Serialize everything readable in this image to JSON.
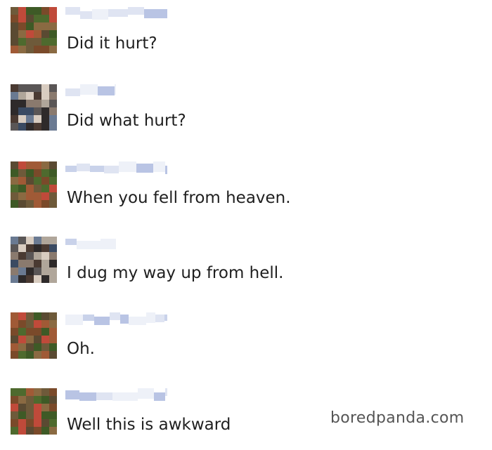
{
  "messages": [
    {
      "sender": "woman",
      "text": "Did it hurt?"
    },
    {
      "sender": "other",
      "text": "Did what hurt?"
    },
    {
      "sender": "woman",
      "text": "When you fell from heaven."
    },
    {
      "sender": "other",
      "text": "I dug my way up from hell."
    },
    {
      "sender": "woman",
      "text": "Oh."
    },
    {
      "sender": "woman",
      "text": "Well this is awkward"
    }
  ],
  "watermark": "boredpanda.com",
  "colors": {
    "sender_blur": [
      "#c9d2ea",
      "#dfe4f2",
      "#b9c4e4",
      "#eef1f8"
    ],
    "avatar_warm": [
      "#6e5a3a",
      "#8a6a42",
      "#4e6a2e",
      "#a05a36",
      "#7a4a2a",
      "#c04a3a",
      "#5a4a32",
      "#3e5a26"
    ],
    "avatar_cool": [
      "#2e2a2a",
      "#5a5656",
      "#8a7a6e",
      "#b0a69a",
      "#3a4a62",
      "#6a7a92",
      "#d8ccc0",
      "#4a3a32"
    ]
  }
}
